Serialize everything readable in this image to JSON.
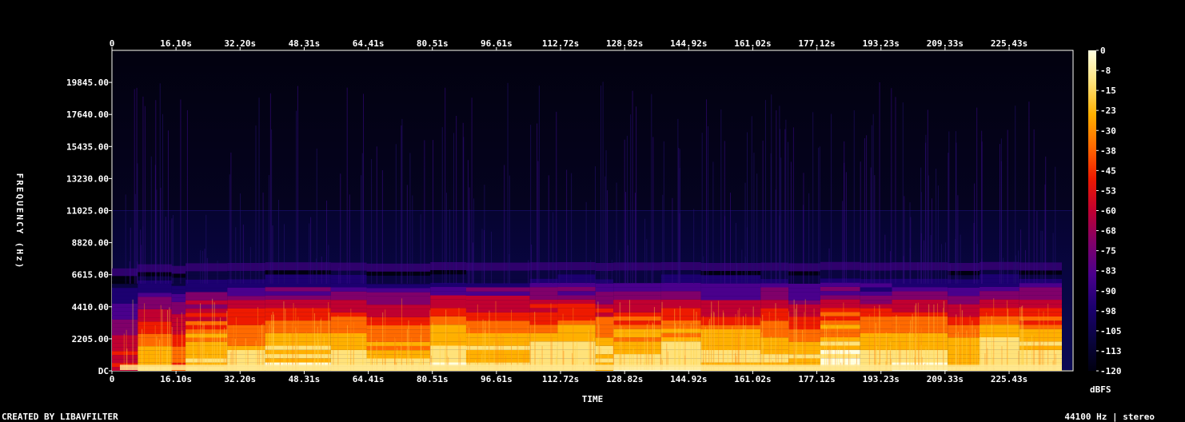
{
  "chart_data": {
    "type": "heatmap",
    "title": "",
    "xlabel": "TIME",
    "ylabel": "FREQUENCY (Hz)",
    "xlim": [
      0,
      241.5
    ],
    "ylim": [
      0,
      22050
    ],
    "x_ticks": [
      "0",
      "16.10s",
      "32.20s",
      "48.31s",
      "64.41s",
      "80.51s",
      "96.61s",
      "112.72s",
      "128.82s",
      "144.92s",
      "161.02s",
      "177.12s",
      "193.23s",
      "209.33s",
      "225.43s"
    ],
    "x_tick_values": [
      0,
      16.1,
      32.2,
      48.31,
      64.41,
      80.51,
      96.61,
      112.72,
      128.82,
      144.92,
      161.02,
      177.12,
      193.23,
      209.33,
      225.43
    ],
    "y_ticks": [
      "DC",
      "2205.00",
      "4410.00",
      "6615.00",
      "8820.00",
      "11025.00",
      "13230.00",
      "15435.00",
      "17640.00",
      "19845.00"
    ],
    "y_tick_values": [
      0,
      2205,
      4410,
      6615,
      8820,
      11025,
      13230,
      15435,
      17640,
      19845
    ],
    "colorbar": {
      "label": "dBFS",
      "range": [
        -120,
        0
      ],
      "ticks": [
        "0",
        "-8",
        "-15",
        "-23",
        "-30",
        "-38",
        "-45",
        "-53",
        "-60",
        "-68",
        "-75",
        "-83",
        "-90",
        "-98",
        "-105",
        "-113",
        "-120"
      ],
      "colors": [
        "#ffffe0",
        "#ffe27a",
        "#ffb000",
        "#ff6a00",
        "#ee1a00",
        "#c00030",
        "#80006a",
        "#4a008c",
        "#1c0070",
        "#0a0440",
        "#000010"
      ]
    },
    "segments_s": [
      [
        0,
        6.5,
        0.55
      ],
      [
        6.5,
        15,
        0.8
      ],
      [
        15,
        18.5,
        0.7
      ],
      [
        18.5,
        29,
        0.86
      ],
      [
        29,
        38.5,
        0.88
      ],
      [
        38.5,
        55,
        0.92
      ],
      [
        55,
        64,
        0.9
      ],
      [
        64,
        80,
        0.84
      ],
      [
        80,
        89,
        0.93
      ],
      [
        89,
        105,
        0.9
      ],
      [
        105,
        112,
        0.92
      ],
      [
        112,
        121.5,
        0.93
      ],
      [
        121.5,
        126,
        0.88
      ],
      [
        126,
        138,
        0.91
      ],
      [
        138,
        148,
        0.93
      ],
      [
        148,
        163,
        0.88
      ],
      [
        163,
        170,
        0.9
      ],
      [
        170,
        178,
        0.86
      ],
      [
        178,
        188,
        0.94
      ],
      [
        188,
        196,
        0.9
      ],
      [
        196,
        210,
        0.92
      ],
      [
        210,
        218,
        0.88
      ],
      [
        218,
        228,
        0.94
      ],
      [
        228,
        240,
        0.91
      ]
    ],
    "harmonic_band_hz": 11025,
    "upper_energy_limit_hz": 7000,
    "grid": false,
    "legend": "right"
  },
  "footer": {
    "left": "CREATED BY LIBAVFILTER",
    "right": "44100 Hz | stereo"
  }
}
